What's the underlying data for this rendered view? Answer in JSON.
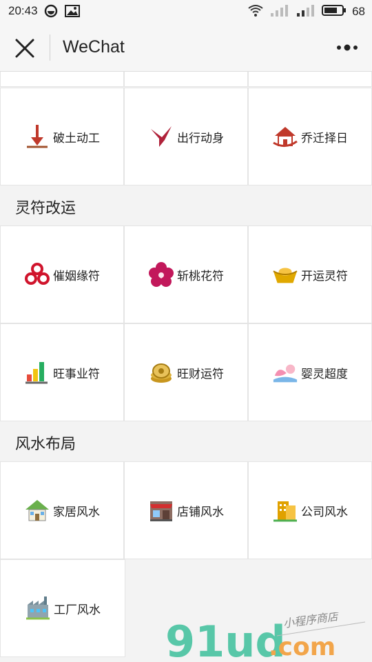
{
  "status_bar": {
    "time": "20:43",
    "battery": "68"
  },
  "nav": {
    "title": "WeChat"
  },
  "sections": [
    {
      "items": [
        {
          "label": "破土动工"
        },
        {
          "label": "出行动身"
        },
        {
          "label": "乔迁择日"
        }
      ]
    },
    {
      "title": "灵符改运",
      "rows": [
        [
          {
            "label": "催姻缘符"
          },
          {
            "label": "斩桃花符"
          },
          {
            "label": "开运灵符"
          }
        ],
        [
          {
            "label": "旺事业符"
          },
          {
            "label": "旺财运符"
          },
          {
            "label": "婴灵超度"
          }
        ]
      ]
    },
    {
      "title": "风水布局",
      "rows": [
        [
          {
            "label": "家居风水"
          },
          {
            "label": "店铺风水"
          },
          {
            "label": "公司风水"
          }
        ],
        [
          {
            "label": "工厂风水"
          }
        ]
      ]
    }
  ],
  "watermark": {
    "brand": "91ud",
    "domain": ".com",
    "tagline": "小程序商店"
  }
}
